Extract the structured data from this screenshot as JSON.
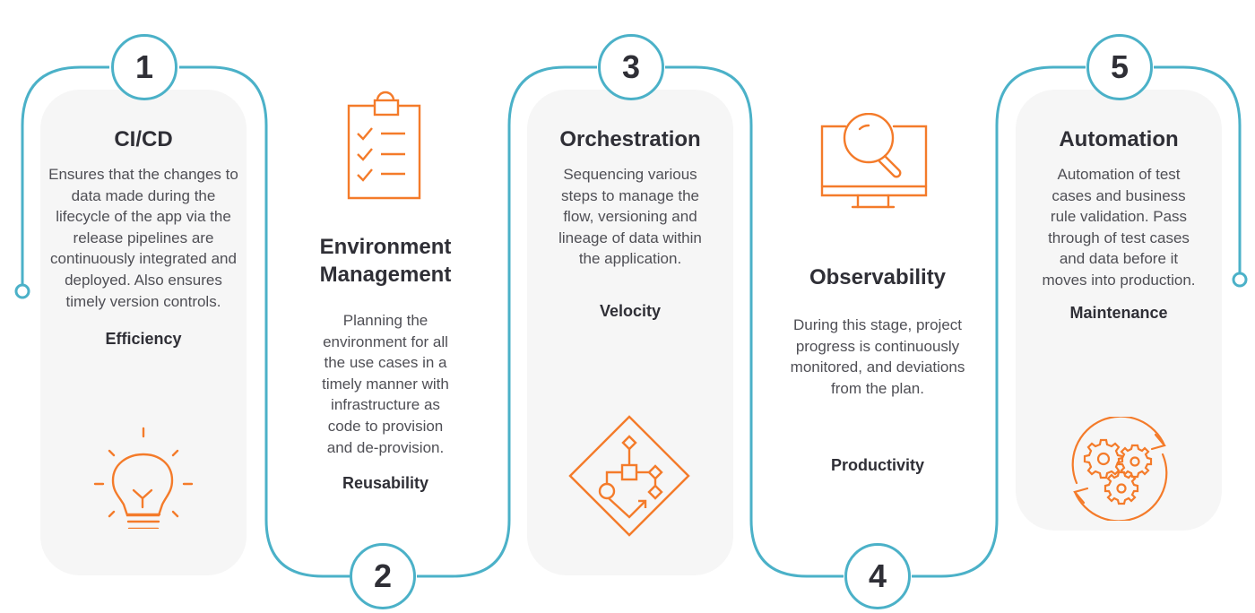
{
  "colors": {
    "connector": "#4bb1c8",
    "icon_accent": "#f47b2a",
    "card_background": "#f6f6f6",
    "text_dark": "#2f2f36",
    "text_body": "#4f4f55"
  },
  "stages": [
    {
      "number": "1",
      "title": "CI/CD",
      "description": "Ensures that the changes to data made during the lifecycle of the app via the release pipelines are continuously integrated and deployed. Also ensures timely version controls.",
      "value": "Efficiency",
      "icon": "lightbulb-icon"
    },
    {
      "number": "2",
      "title": "Environment Management",
      "description": "Planning the environment for all the use cases in a timely manner with infrastructure as code to provision and de-provision.",
      "value": "Reusability",
      "icon": "clipboard-checklist-icon"
    },
    {
      "number": "3",
      "title": "Orchestration",
      "description": "Sequencing various steps to manage the flow, versioning and lineage of data within the application.",
      "value": "Velocity",
      "icon": "workflow-diagram-icon"
    },
    {
      "number": "4",
      "title": "Observability",
      "description": "During this stage, project progress is continuously monitored, and deviations from the plan.",
      "value": "Productivity",
      "icon": "monitor-magnifier-icon"
    },
    {
      "number": "5",
      "title": "Automation",
      "description": "Automation of test cases and business rule validation. Pass through of test cases and data before it moves into production.",
      "value": "Maintenance",
      "icon": "gears-cycle-icon"
    }
  ]
}
